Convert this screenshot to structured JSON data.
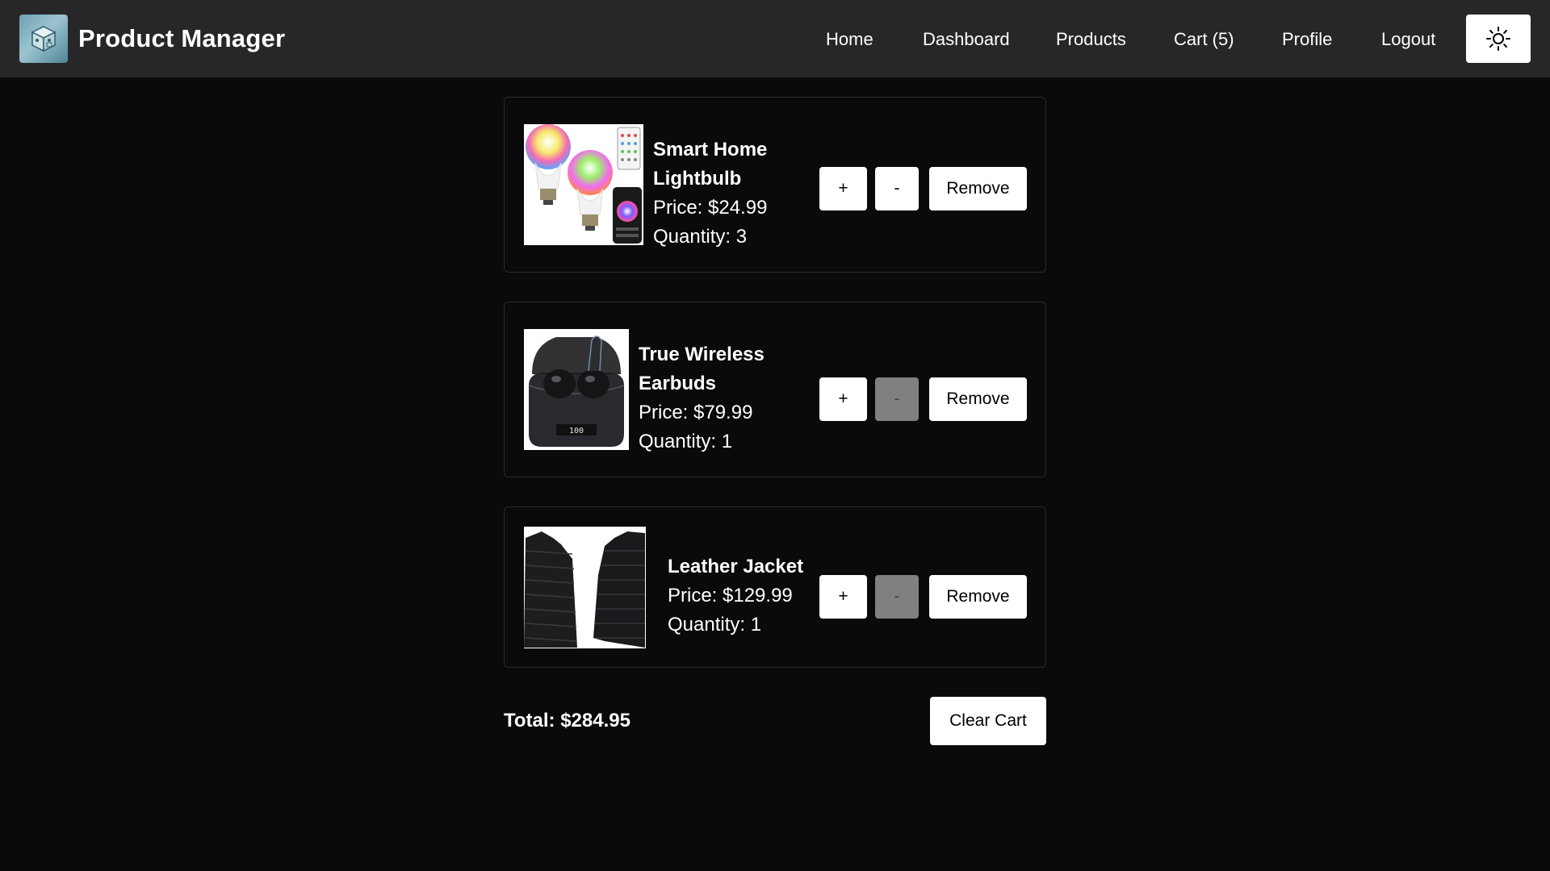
{
  "navbar": {
    "brand_title": "Product Manager",
    "logo_icon": "cube-box-icon",
    "links": [
      {
        "label": "Home"
      },
      {
        "label": "Dashboard"
      },
      {
        "label": "Products"
      },
      {
        "label": "Cart (5)"
      },
      {
        "label": "Profile"
      },
      {
        "label": "Logout"
      }
    ],
    "theme_toggle_icon": "sun-icon"
  },
  "cart": {
    "items": [
      {
        "name_line1": "Smart Home",
        "name_line2": "Lightbulb",
        "price": "Price: $24.99",
        "quantity": "Quantity: 3",
        "minus_disabled": false
      },
      {
        "name_line1": "True Wireless",
        "name_line2": "Earbuds",
        "price": "Price: $79.99",
        "quantity": "Quantity: 1",
        "minus_disabled": true
      },
      {
        "name_line1": "Leather Jacket",
        "name_line2": "",
        "price": "Price: $129.99",
        "quantity": "Quantity: 1",
        "minus_disabled": true
      }
    ],
    "buttons": {
      "plus": "+",
      "minus": "-",
      "remove": "Remove"
    },
    "total": "Total: $284.95",
    "clear_label": "Clear Cart"
  },
  "colors": {
    "background": "#0a0a0c",
    "navbar": "#272729",
    "button": "#ffffff",
    "disabled_button": "#808080"
  }
}
